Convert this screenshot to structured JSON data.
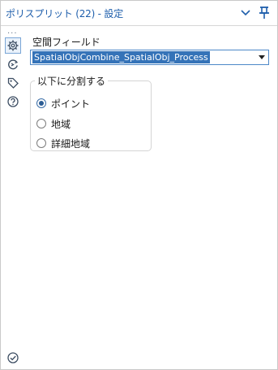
{
  "window": {
    "title": "ポリスプリット (22) - 設定",
    "accent_color": "#1e5eab"
  },
  "titlebar_icons": [
    "chevron-down-icon",
    "pin-icon"
  ],
  "rail": {
    "overflow_label": "...",
    "items": [
      {
        "icon": "gear-icon",
        "active": true
      },
      {
        "icon": "connection-icon",
        "active": false
      },
      {
        "icon": "tag-icon",
        "active": false
      },
      {
        "icon": "help-icon",
        "active": false
      }
    ],
    "bottom_icon": "check-circle-icon"
  },
  "spatial_field": {
    "label": "空間フィールド",
    "selected_value": "SpatialObjCombine_SpatialObj_Process"
  },
  "split_group": {
    "legend": "以下に分割する",
    "options": [
      {
        "label": "ポイント",
        "selected": true
      },
      {
        "label": "地域",
        "selected": false
      },
      {
        "label": "詳細地域",
        "selected": false
      }
    ]
  }
}
